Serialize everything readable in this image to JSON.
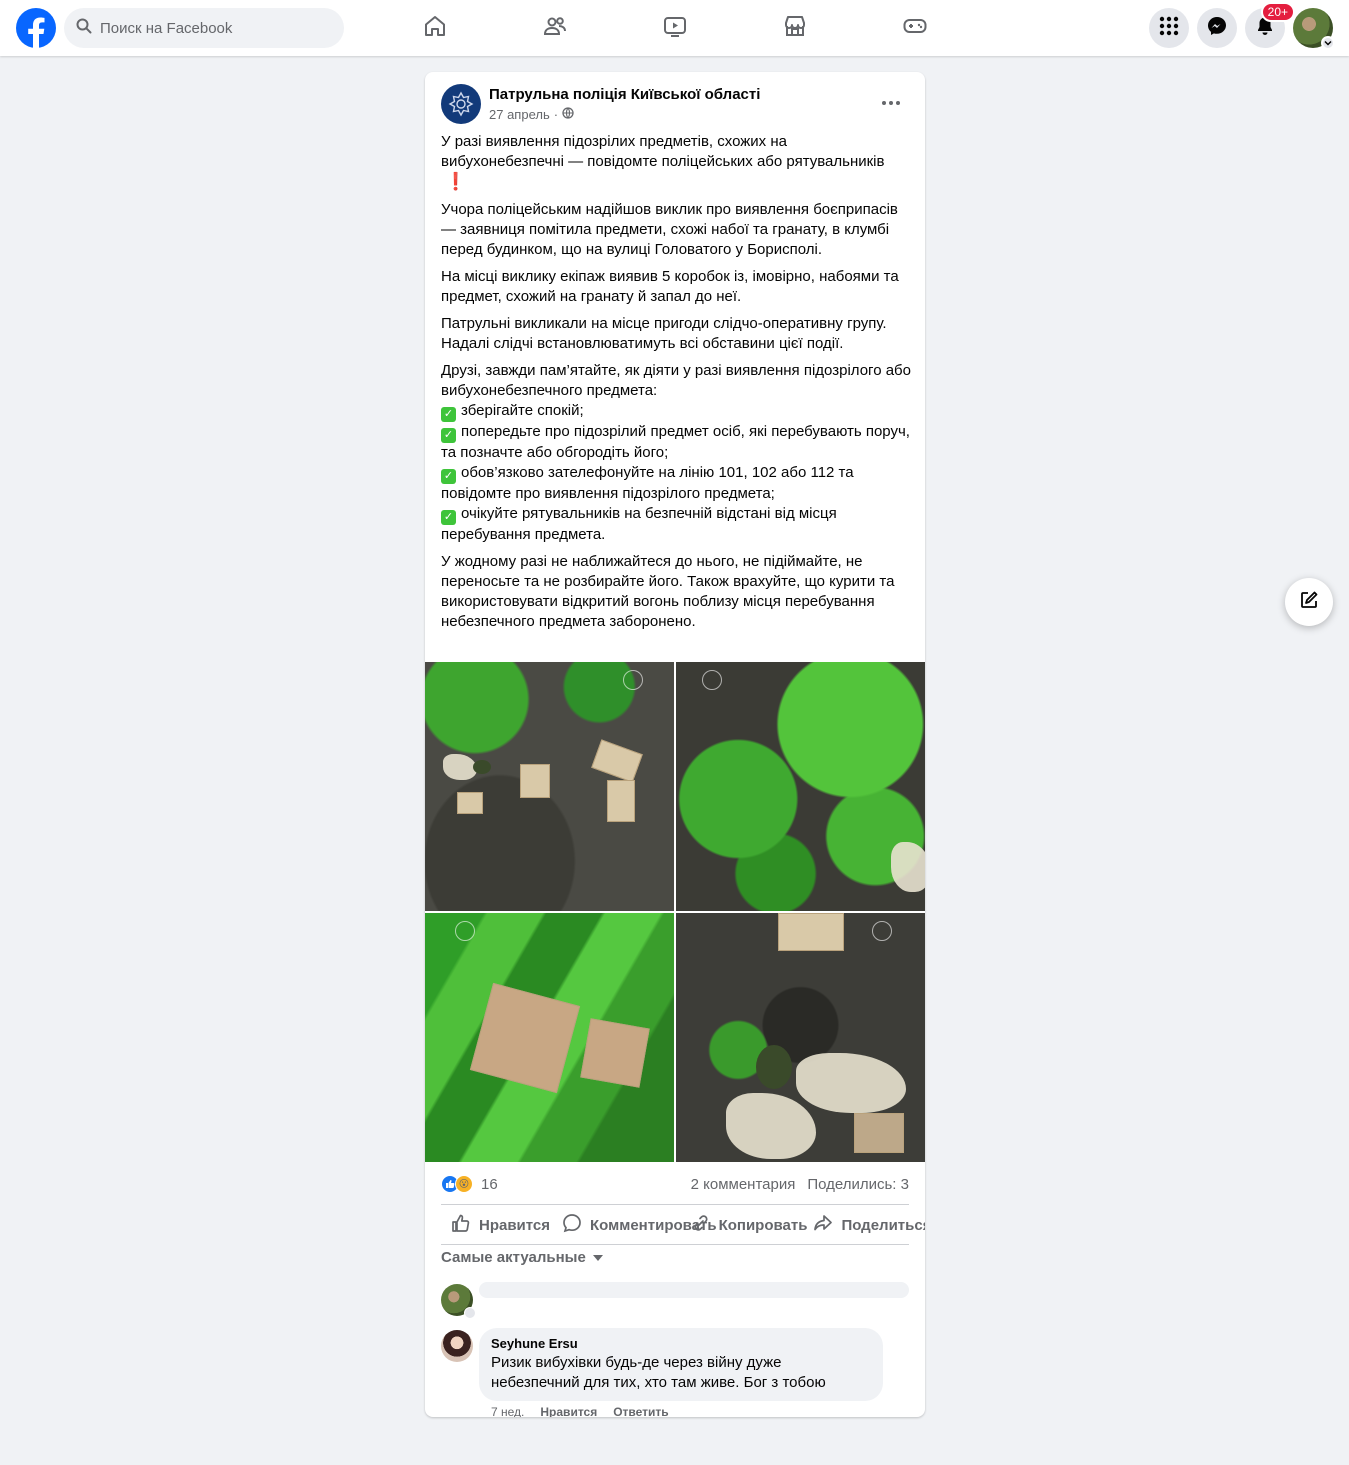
{
  "topbar": {
    "search_placeholder": "Поиск на Facebook",
    "notification_badge": "20+"
  },
  "post": {
    "page_name": "Патрульна поліція Київської області",
    "date": "27 апрель",
    "meta_separator": "·",
    "paragraphs": {
      "p1": "У разі виявлення підозрілих предметів, схожих на вибухонебезпечні — повідомте поліцейських або рятувальників",
      "p1_emoji": "❗",
      "p2": "Учора поліцейським надійшов виклик про виявлення боєприпасів — заявниця помітила предмети, схожі набої та гранату, в клумбі перед будинком, що на вулиці Головатого у Борисполі.",
      "p3": "На місці виклику екіпаж виявив 5 коробок із, імовірно, набоями та предмет, схожий на гранату й запал до неї.",
      "p4": "Патрульні викликали на місце пригоди слідчо-оперативну групу. Надалі слідчі встановлюватимуть всі обставини цієї події.",
      "p5_intro": "Друзі, завжди пам’ятайте, як діяти у разі виявлення підозрілого або вибухонебезпечного предмета:",
      "p5_items": [
        "зберігайте спокій;",
        "попередьте про підозрілий предмет осіб, які перебувають поруч, та позначте або обгородіть його;",
        "обов’язково зателефонуйте на лінію 101, 102 або 112 та повідомте про виявлення підозрілого предмета;",
        "очікуйте рятувальників на безпечній відстані від місця перебування предмета."
      ],
      "p6": "У жодному разі не наближайтеся до нього, не підіймайте, не переносьте та не розбирайте його. Також врахуйте, що курити та використовувати відкритий вогонь поблизу місця перебування небезпечного предмета заборонено."
    },
    "reactions_count": "16",
    "comments_count": "2 комментария",
    "shares_count": "Поделились: 3",
    "actions": {
      "like": "Нравится",
      "comment": "Комментировать",
      "copy": "Копировать",
      "share": "Поделиться"
    },
    "sort_label": "Самые актуальные"
  },
  "comments": [
    {
      "author": "Seyhune Ersu",
      "text": "Ризик вибухівки будь-де через війну дуже небезпечний для тих, хто там живе. Бог з тобою",
      "time": "7 нед.",
      "like": "Нравится",
      "reply": "Ответить"
    }
  ],
  "colors": {
    "brand": "#0866ff",
    "badge": "#e41e3f",
    "background": "#f0f2f5"
  },
  "icons": [
    "facebook-logo-icon",
    "search-icon",
    "home-icon",
    "friends-icon",
    "watch-icon",
    "marketplace-icon",
    "gaming-icon",
    "menu-grid-icon",
    "messenger-icon",
    "bell-icon",
    "globe-icon",
    "more-dots-icon",
    "like-icon",
    "comment-icon",
    "copy-icon",
    "share-icon",
    "compose-icon"
  ]
}
